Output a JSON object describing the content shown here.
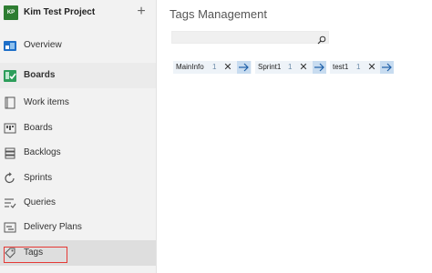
{
  "project": {
    "avatar": "KP",
    "name": "Kim Test Project",
    "avatar_color": "#2e7d32",
    "add_label": "+"
  },
  "nav": {
    "overview": "Overview",
    "boards_section": "Boards",
    "work_items": "Work items",
    "boards": "Boards",
    "backlogs": "Backlogs",
    "sprints": "Sprints",
    "queries": "Queries",
    "delivery_plans": "Delivery Plans",
    "tags": "Tags"
  },
  "main": {
    "title": "Tags Management",
    "search_placeholder": "",
    "tags": [
      {
        "name": "MainInfo",
        "count": "1"
      },
      {
        "name": "Sprint1",
        "count": "1"
      },
      {
        "name": "test1",
        "count": "1"
      }
    ]
  },
  "colors": {
    "accent": "#0078d4",
    "highlight": "#e53935",
    "tag_bg": "#eef3f8",
    "tag_arrow_bg": "#c8dcf0"
  }
}
